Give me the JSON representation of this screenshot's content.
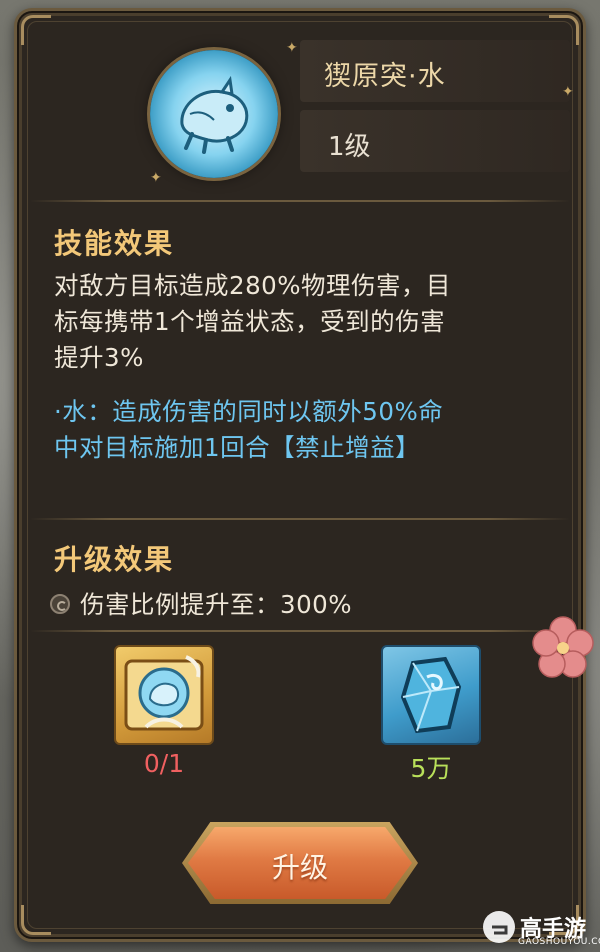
{
  "skill": {
    "name": "猰原突·水",
    "level": "1级",
    "icon": "water-beast-icon"
  },
  "effect": {
    "title": "技能效果",
    "lines": [
      "对敌方目标造成280%物理伤害，目",
      "标每携带1个增益状态，受到的伤害",
      "提升3%"
    ],
    "water_lines": [
      "·水：造成伤害的同时以额外50%命",
      "中对目标施加1回合【禁止增益】"
    ]
  },
  "upgrade": {
    "title": "升级效果",
    "line": "伤害比例提升至：300%"
  },
  "costs": [
    {
      "icon": "skill-scroll-icon",
      "amount": "0/1",
      "color": "#f06060"
    },
    {
      "icon": "water-crystal-icon",
      "amount": "5万",
      "color": "#b9e05a"
    }
  ],
  "button": {
    "label": "升级"
  },
  "watermark": {
    "text": "高手游",
    "sub": "GAOSHOUYOU.COM"
  },
  "colors": {
    "accent": "#f3c879",
    "water": "#6ec6f0",
    "panel": "#2c2620"
  }
}
